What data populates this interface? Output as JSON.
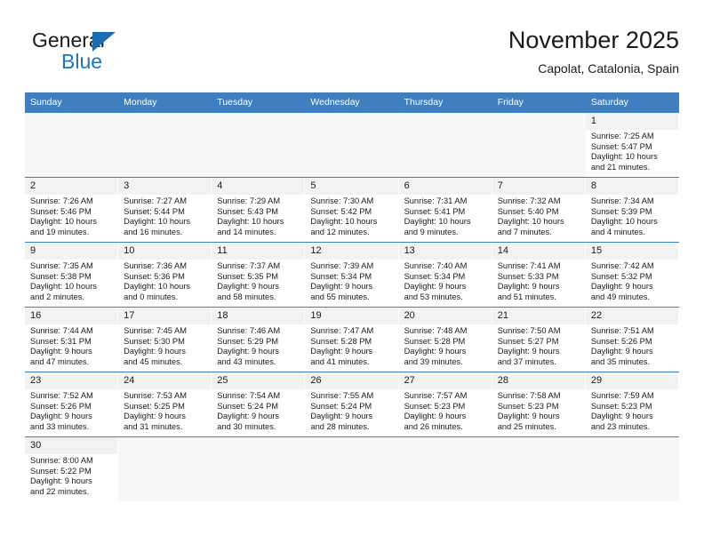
{
  "brand": {
    "name_part1": "General",
    "name_part2": "Blue",
    "triangle_icon": "triangle-icon",
    "colors": {
      "blue": "#1b76bc",
      "dark": "#1a1a1a"
    }
  },
  "header": {
    "title": "November 2025",
    "subtitle": "Capolat, Catalonia, Spain"
  },
  "theme": {
    "header_row_bg": "#3f7fbf",
    "header_row_text": "#ffffff",
    "daynum_bg": "#f2f2f2",
    "empty_cell_bg": "#f7f7f7",
    "cell_border": "#3f7fbf"
  },
  "weekdays": [
    {
      "label": "Sunday"
    },
    {
      "label": "Monday"
    },
    {
      "label": "Tuesday"
    },
    {
      "label": "Wednesday"
    },
    {
      "label": "Thursday"
    },
    {
      "label": "Friday"
    },
    {
      "label": "Saturday"
    }
  ],
  "weeks": [
    [
      {
        "empty": true
      },
      {
        "empty": true
      },
      {
        "empty": true
      },
      {
        "empty": true
      },
      {
        "empty": true
      },
      {
        "empty": true
      },
      {
        "day": "1",
        "sunrise": "Sunrise: 7:25 AM",
        "sunset": "Sunset: 5:47 PM",
        "daylight_line1": "Daylight: 10 hours",
        "daylight_line2": "and 21 minutes."
      }
    ],
    [
      {
        "day": "2",
        "sunrise": "Sunrise: 7:26 AM",
        "sunset": "Sunset: 5:46 PM",
        "daylight_line1": "Daylight: 10 hours",
        "daylight_line2": "and 19 minutes."
      },
      {
        "day": "3",
        "sunrise": "Sunrise: 7:27 AM",
        "sunset": "Sunset: 5:44 PM",
        "daylight_line1": "Daylight: 10 hours",
        "daylight_line2": "and 16 minutes."
      },
      {
        "day": "4",
        "sunrise": "Sunrise: 7:29 AM",
        "sunset": "Sunset: 5:43 PM",
        "daylight_line1": "Daylight: 10 hours",
        "daylight_line2": "and 14 minutes."
      },
      {
        "day": "5",
        "sunrise": "Sunrise: 7:30 AM",
        "sunset": "Sunset: 5:42 PM",
        "daylight_line1": "Daylight: 10 hours",
        "daylight_line2": "and 12 minutes."
      },
      {
        "day": "6",
        "sunrise": "Sunrise: 7:31 AM",
        "sunset": "Sunset: 5:41 PM",
        "daylight_line1": "Daylight: 10 hours",
        "daylight_line2": "and 9 minutes."
      },
      {
        "day": "7",
        "sunrise": "Sunrise: 7:32 AM",
        "sunset": "Sunset: 5:40 PM",
        "daylight_line1": "Daylight: 10 hours",
        "daylight_line2": "and 7 minutes."
      },
      {
        "day": "8",
        "sunrise": "Sunrise: 7:34 AM",
        "sunset": "Sunset: 5:39 PM",
        "daylight_line1": "Daylight: 10 hours",
        "daylight_line2": "and 4 minutes."
      }
    ],
    [
      {
        "day": "9",
        "sunrise": "Sunrise: 7:35 AM",
        "sunset": "Sunset: 5:38 PM",
        "daylight_line1": "Daylight: 10 hours",
        "daylight_line2": "and 2 minutes."
      },
      {
        "day": "10",
        "sunrise": "Sunrise: 7:36 AM",
        "sunset": "Sunset: 5:36 PM",
        "daylight_line1": "Daylight: 10 hours",
        "daylight_line2": "and 0 minutes."
      },
      {
        "day": "11",
        "sunrise": "Sunrise: 7:37 AM",
        "sunset": "Sunset: 5:35 PM",
        "daylight_line1": "Daylight: 9 hours",
        "daylight_line2": "and 58 minutes."
      },
      {
        "day": "12",
        "sunrise": "Sunrise: 7:39 AM",
        "sunset": "Sunset: 5:34 PM",
        "daylight_line1": "Daylight: 9 hours",
        "daylight_line2": "and 55 minutes."
      },
      {
        "day": "13",
        "sunrise": "Sunrise: 7:40 AM",
        "sunset": "Sunset: 5:34 PM",
        "daylight_line1": "Daylight: 9 hours",
        "daylight_line2": "and 53 minutes."
      },
      {
        "day": "14",
        "sunrise": "Sunrise: 7:41 AM",
        "sunset": "Sunset: 5:33 PM",
        "daylight_line1": "Daylight: 9 hours",
        "daylight_line2": "and 51 minutes."
      },
      {
        "day": "15",
        "sunrise": "Sunrise: 7:42 AM",
        "sunset": "Sunset: 5:32 PM",
        "daylight_line1": "Daylight: 9 hours",
        "daylight_line2": "and 49 minutes."
      }
    ],
    [
      {
        "day": "16",
        "sunrise": "Sunrise: 7:44 AM",
        "sunset": "Sunset: 5:31 PM",
        "daylight_line1": "Daylight: 9 hours",
        "daylight_line2": "and 47 minutes."
      },
      {
        "day": "17",
        "sunrise": "Sunrise: 7:45 AM",
        "sunset": "Sunset: 5:30 PM",
        "daylight_line1": "Daylight: 9 hours",
        "daylight_line2": "and 45 minutes."
      },
      {
        "day": "18",
        "sunrise": "Sunrise: 7:46 AM",
        "sunset": "Sunset: 5:29 PM",
        "daylight_line1": "Daylight: 9 hours",
        "daylight_line2": "and 43 minutes."
      },
      {
        "day": "19",
        "sunrise": "Sunrise: 7:47 AM",
        "sunset": "Sunset: 5:28 PM",
        "daylight_line1": "Daylight: 9 hours",
        "daylight_line2": "and 41 minutes."
      },
      {
        "day": "20",
        "sunrise": "Sunrise: 7:48 AM",
        "sunset": "Sunset: 5:28 PM",
        "daylight_line1": "Daylight: 9 hours",
        "daylight_line2": "and 39 minutes."
      },
      {
        "day": "21",
        "sunrise": "Sunrise: 7:50 AM",
        "sunset": "Sunset: 5:27 PM",
        "daylight_line1": "Daylight: 9 hours",
        "daylight_line2": "and 37 minutes."
      },
      {
        "day": "22",
        "sunrise": "Sunrise: 7:51 AM",
        "sunset": "Sunset: 5:26 PM",
        "daylight_line1": "Daylight: 9 hours",
        "daylight_line2": "and 35 minutes."
      }
    ],
    [
      {
        "day": "23",
        "sunrise": "Sunrise: 7:52 AM",
        "sunset": "Sunset: 5:26 PM",
        "daylight_line1": "Daylight: 9 hours",
        "daylight_line2": "and 33 minutes."
      },
      {
        "day": "24",
        "sunrise": "Sunrise: 7:53 AM",
        "sunset": "Sunset: 5:25 PM",
        "daylight_line1": "Daylight: 9 hours",
        "daylight_line2": "and 31 minutes."
      },
      {
        "day": "25",
        "sunrise": "Sunrise: 7:54 AM",
        "sunset": "Sunset: 5:24 PM",
        "daylight_line1": "Daylight: 9 hours",
        "daylight_line2": "and 30 minutes."
      },
      {
        "day": "26",
        "sunrise": "Sunrise: 7:55 AM",
        "sunset": "Sunset: 5:24 PM",
        "daylight_line1": "Daylight: 9 hours",
        "daylight_line2": "and 28 minutes."
      },
      {
        "day": "27",
        "sunrise": "Sunrise: 7:57 AM",
        "sunset": "Sunset: 5:23 PM",
        "daylight_line1": "Daylight: 9 hours",
        "daylight_line2": "and 26 minutes."
      },
      {
        "day": "28",
        "sunrise": "Sunrise: 7:58 AM",
        "sunset": "Sunset: 5:23 PM",
        "daylight_line1": "Daylight: 9 hours",
        "daylight_line2": "and 25 minutes."
      },
      {
        "day": "29",
        "sunrise": "Sunrise: 7:59 AM",
        "sunset": "Sunset: 5:23 PM",
        "daylight_line1": "Daylight: 9 hours",
        "daylight_line2": "and 23 minutes."
      }
    ],
    [
      {
        "day": "30",
        "sunrise": "Sunrise: 8:00 AM",
        "sunset": "Sunset: 5:22 PM",
        "daylight_line1": "Daylight: 9 hours",
        "daylight_line2": "and 22 minutes."
      },
      {
        "empty": true
      },
      {
        "empty": true
      },
      {
        "empty": true
      },
      {
        "empty": true
      },
      {
        "empty": true
      },
      {
        "empty": true
      }
    ]
  ]
}
